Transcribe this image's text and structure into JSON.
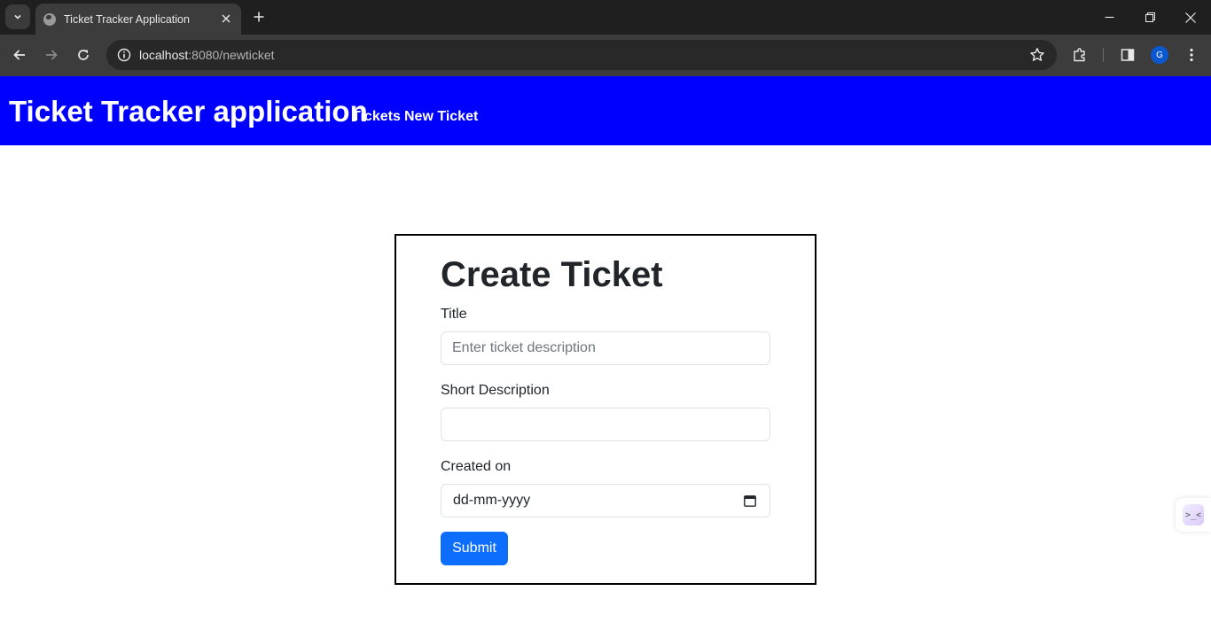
{
  "browser": {
    "tab_title": "Ticket Tracker Application",
    "url_host": "localhost",
    "url_path": ":8080/newticket",
    "profile_initial": "G",
    "icons": [
      "tab-search-icon",
      "globe-icon",
      "close-icon",
      "plus-icon",
      "minimize-icon",
      "restore-icon",
      "window-close-icon",
      "back-arrow-icon",
      "forward-arrow-icon",
      "reload-icon",
      "site-info-icon",
      "star-icon",
      "extensions-icon",
      "sidebar-icon",
      "kebab-menu-icon"
    ]
  },
  "navbar": {
    "brand": "Ticket Tracker application",
    "links": [
      "Tickets",
      "New Ticket"
    ],
    "background": "#0000ff"
  },
  "form": {
    "heading": "Create Ticket",
    "title_label": "Title",
    "title_placeholder": "Enter ticket description",
    "title_value": "",
    "short_description_label": "Short Description",
    "short_description_value": "",
    "created_on_label": "Created on",
    "created_on_placeholder": "dd-mm-yyyy",
    "submit_label": "Submit",
    "submit_color": "#0d6efd"
  },
  "side_widget": {
    "icon": "devtools-widget-icon",
    "glyph": ">_<"
  }
}
